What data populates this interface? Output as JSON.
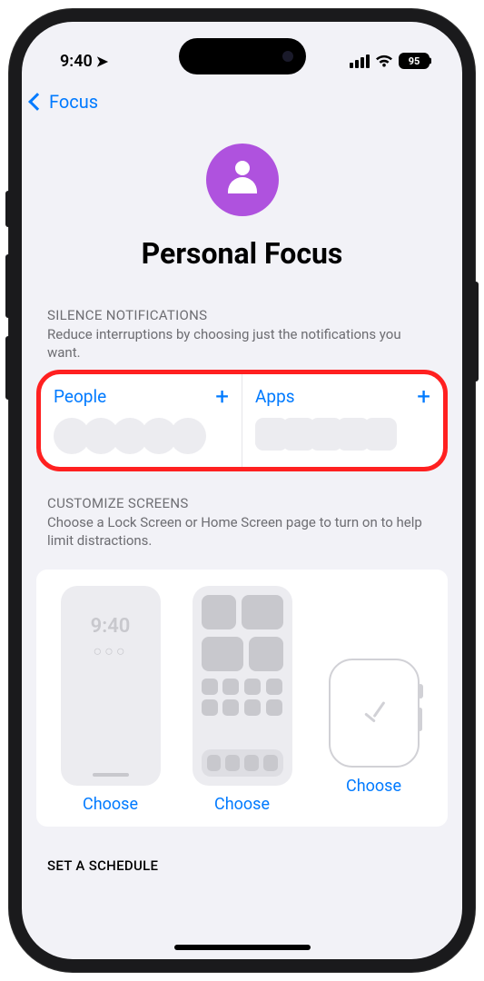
{
  "status": {
    "time": "9:40",
    "battery": "95"
  },
  "nav": {
    "back_label": "Focus"
  },
  "header": {
    "title": "Personal Focus"
  },
  "silence": {
    "title": "SILENCE NOTIFICATIONS",
    "desc": "Reduce interruptions by choosing just the notifications you want.",
    "people_label": "People",
    "apps_label": "Apps"
  },
  "screens": {
    "title": "CUSTOMIZE SCREENS",
    "desc": "Choose a Lock Screen or Home Screen page to turn on to help limit distractions.",
    "lock_time": "9:40",
    "choose_label": "Choose"
  },
  "schedule": {
    "title": "SET A SCHEDULE"
  }
}
